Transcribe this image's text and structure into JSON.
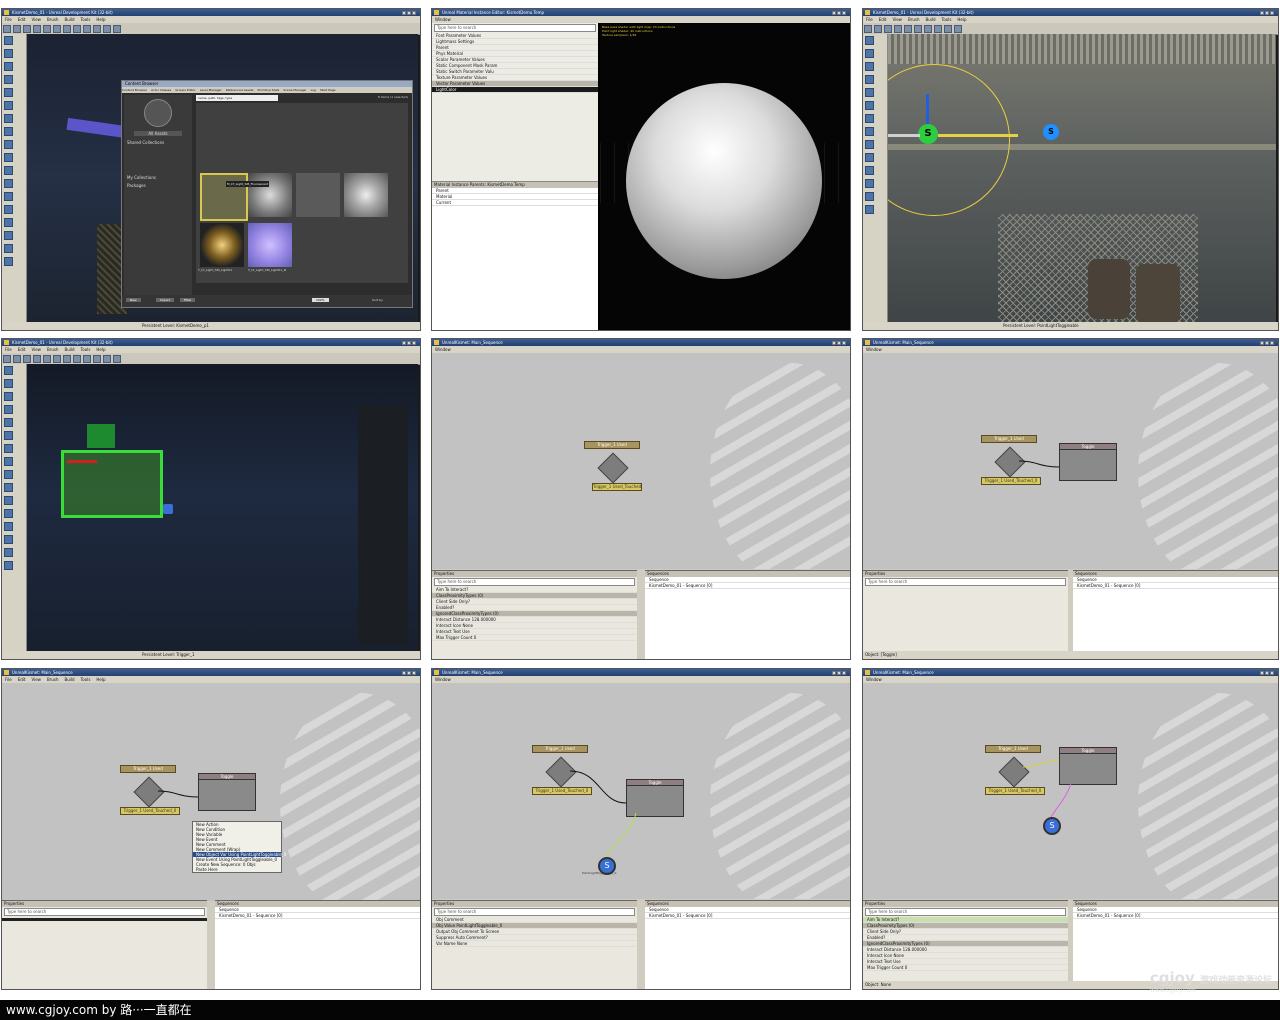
{
  "panels": {
    "p1": {
      "title": "KismetDemo_01 - Unreal Development Kit (32-bit)",
      "status": "Persistent Level: KismetDemo_p1"
    },
    "p2": {
      "title": "Unreal Material Instance Editor: KismetDemo.Temp",
      "status": ""
    },
    "p3": {
      "title": "KismetDemo_01 - Unreal Development Kit (32-bit)",
      "status": "Persistent Level: PointLightToggleable"
    },
    "p4": {
      "title": "KismetDemo_01 - Unreal Development Kit (32-bit)",
      "status": "Persistent Level: Trigger_1"
    },
    "p5": {
      "title": "UnrealKismet: Main_Sequence",
      "status": ""
    },
    "p6": {
      "title": "UnrealKismet: Main_Sequence",
      "status": "Object: [Toggle]"
    },
    "p7": {
      "title": "UnrealKismet: Main_Sequence",
      "status": ""
    },
    "p8": {
      "title": "UnrealKismet: Main_Sequence",
      "status": ""
    },
    "p9": {
      "title": "UnrealKismet: Main_Sequence",
      "status": "Object: None"
    }
  },
  "menu": [
    "File",
    "Edit",
    "View",
    "Brush",
    "Build",
    "Tools",
    "Help"
  ],
  "kismet_menu": [
    "Window"
  ],
  "content_browser": {
    "title": "Content Browser",
    "tabs": [
      "Content Browser",
      "Actor Classes",
      "Groups Editor",
      "Level Manager",
      "Referenced Assets",
      "Primitive Stats",
      "Scene Manager",
      "Log",
      "Start Page"
    ],
    "all_assets": "All Assets",
    "shared_collections": "Shared Collections",
    "my_collections": "My Collections",
    "packages": "Packages",
    "search_value": "name, path, tags, type",
    "items_count": "8 items (1 selected)",
    "assets": [
      "M_LT_Light_SM_Fluorescent",
      "T_LT_Light_SM_Light01",
      "T_LT_Light_SM_Light01_N"
    ],
    "buttons": [
      "New",
      "Import",
      "Filter"
    ],
    "zoom": "100%",
    "sort": "Sort by"
  },
  "material_editor": {
    "menu": "Window",
    "search_placeholder": "Type here to search",
    "info": [
      "Base pass shader with light map: 23 instructions",
      "Point light shader: 40 instructions",
      "Texture samplers: 1/16"
    ],
    "props": [
      "Font Parameter Values",
      "Lightmass Settings",
      "Parent",
      "Phys Material",
      "Scalar Parameter Values",
      "Static Component Mask Param",
      "Static Switch Parameter Valu",
      "Texture Parameter Values",
      "Vector Parameter Values",
      "LightColor"
    ],
    "bottom_header": "Material Instance Parents: KismetDemo.Temp",
    "bottom_rows": [
      "Parent",
      "Material",
      "Current"
    ]
  },
  "kismet": {
    "search_placeholder": "Type here to search",
    "properties_label": "Properties",
    "sequences_label": "Sequences",
    "sequence_root": "Sequence",
    "sequence_item": "KismetDemo_01 - Sequence [0]",
    "trigger_label": "Trigger_1 Used",
    "trigger_sub": "Trigger_1 Used_Touched_0",
    "toggle_label": "Toggle",
    "light_var": "PointLightToggleable_0",
    "trigger_props": [
      {
        "name": "Aim To Interact?",
        "value": ""
      },
      {
        "name": "ClassProximityTypes",
        "value": "(0)"
      },
      {
        "name": "Client Side Only?",
        "value": ""
      },
      {
        "name": "Enabled?",
        "value": ""
      },
      {
        "name": "IgnoredClassProximityTypes",
        "value": "(0)"
      },
      {
        "name": "Interact Distance",
        "value": "128.000000"
      },
      {
        "name": "Interact Icon",
        "value": "None"
      },
      {
        "name": "Interact Text",
        "value": "Use"
      },
      {
        "name": "Max Trigger Count",
        "value": "0"
      }
    ],
    "var_props": [
      {
        "name": "Obj Comment",
        "value": ""
      },
      {
        "name": "Obj Value",
        "value": "PointLightToggleable_0"
      },
      {
        "name": "Output Obj Comment To Screen",
        "value": ""
      },
      {
        "name": "Suppress Auto Comment?",
        "value": ""
      },
      {
        "name": "Var Name",
        "value": "None"
      }
    ],
    "context_menu": [
      "New Action",
      "New Condition",
      "New Variable",
      "New Event",
      "New Comment",
      "New Comment (Wrap)",
      "New Object Var Using PointLightToggleable_0",
      "New Event Using PointLightToggleable_0",
      "Create New Sequence: 0 Objs",
      "Paste Here"
    ]
  },
  "watermark": {
    "logo": "cgjoy",
    "cn": "游戏动画资源论坛",
    "url": "www.cgjoy.com"
  },
  "footer": "www.cgjoy.com by 路···一直都在",
  "colors": {
    "accent": "#2a4a8a",
    "grid": "#c2c2c2",
    "gizmo_green": "#2ecc40",
    "gizmo_blue": "#1e90ff"
  }
}
